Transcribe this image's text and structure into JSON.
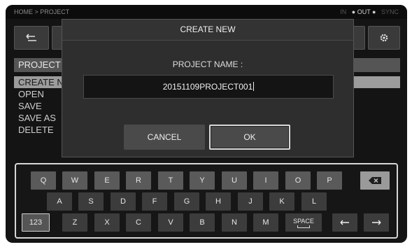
{
  "status": {
    "breadcrumb": "HOME > PROJECT",
    "right_indicators": [
      "IN",
      "OUT",
      "SYNC"
    ],
    "active_indicator": "OUT"
  },
  "menu": {
    "header": "PROJECT",
    "items": [
      "CREATE NEW",
      "OPEN",
      "SAVE",
      "SAVE AS",
      "DELETE"
    ],
    "selected_index": 0
  },
  "dialog": {
    "title": "CREATE NEW",
    "field_label": "PROJECT NAME :",
    "field_value": "20151109PROJECT001",
    "cancel_label": "CANCEL",
    "ok_label": "OK"
  },
  "keyboard": {
    "row1": [
      "Q",
      "W",
      "E",
      "R",
      "T",
      "Y",
      "U",
      "I",
      "O",
      "P"
    ],
    "row2": [
      "A",
      "S",
      "D",
      "F",
      "G",
      "H",
      "J",
      "K",
      "L"
    ],
    "row3": [
      "Z",
      "X",
      "C",
      "V",
      "B",
      "N",
      "M"
    ],
    "mode_label": "123",
    "space_label": "SPACE",
    "backspace_icon": "backspace-icon",
    "left_icon": "arrow-left-icon",
    "right_icon": "arrow-right-icon"
  },
  "colors": {
    "screen_bg": "#141414",
    "dialog_bg": "#2e2e2e",
    "key_bg": "#5a5a5a",
    "selected_row": "#9c9c9c",
    "focus_border": "#d8d8d8"
  }
}
